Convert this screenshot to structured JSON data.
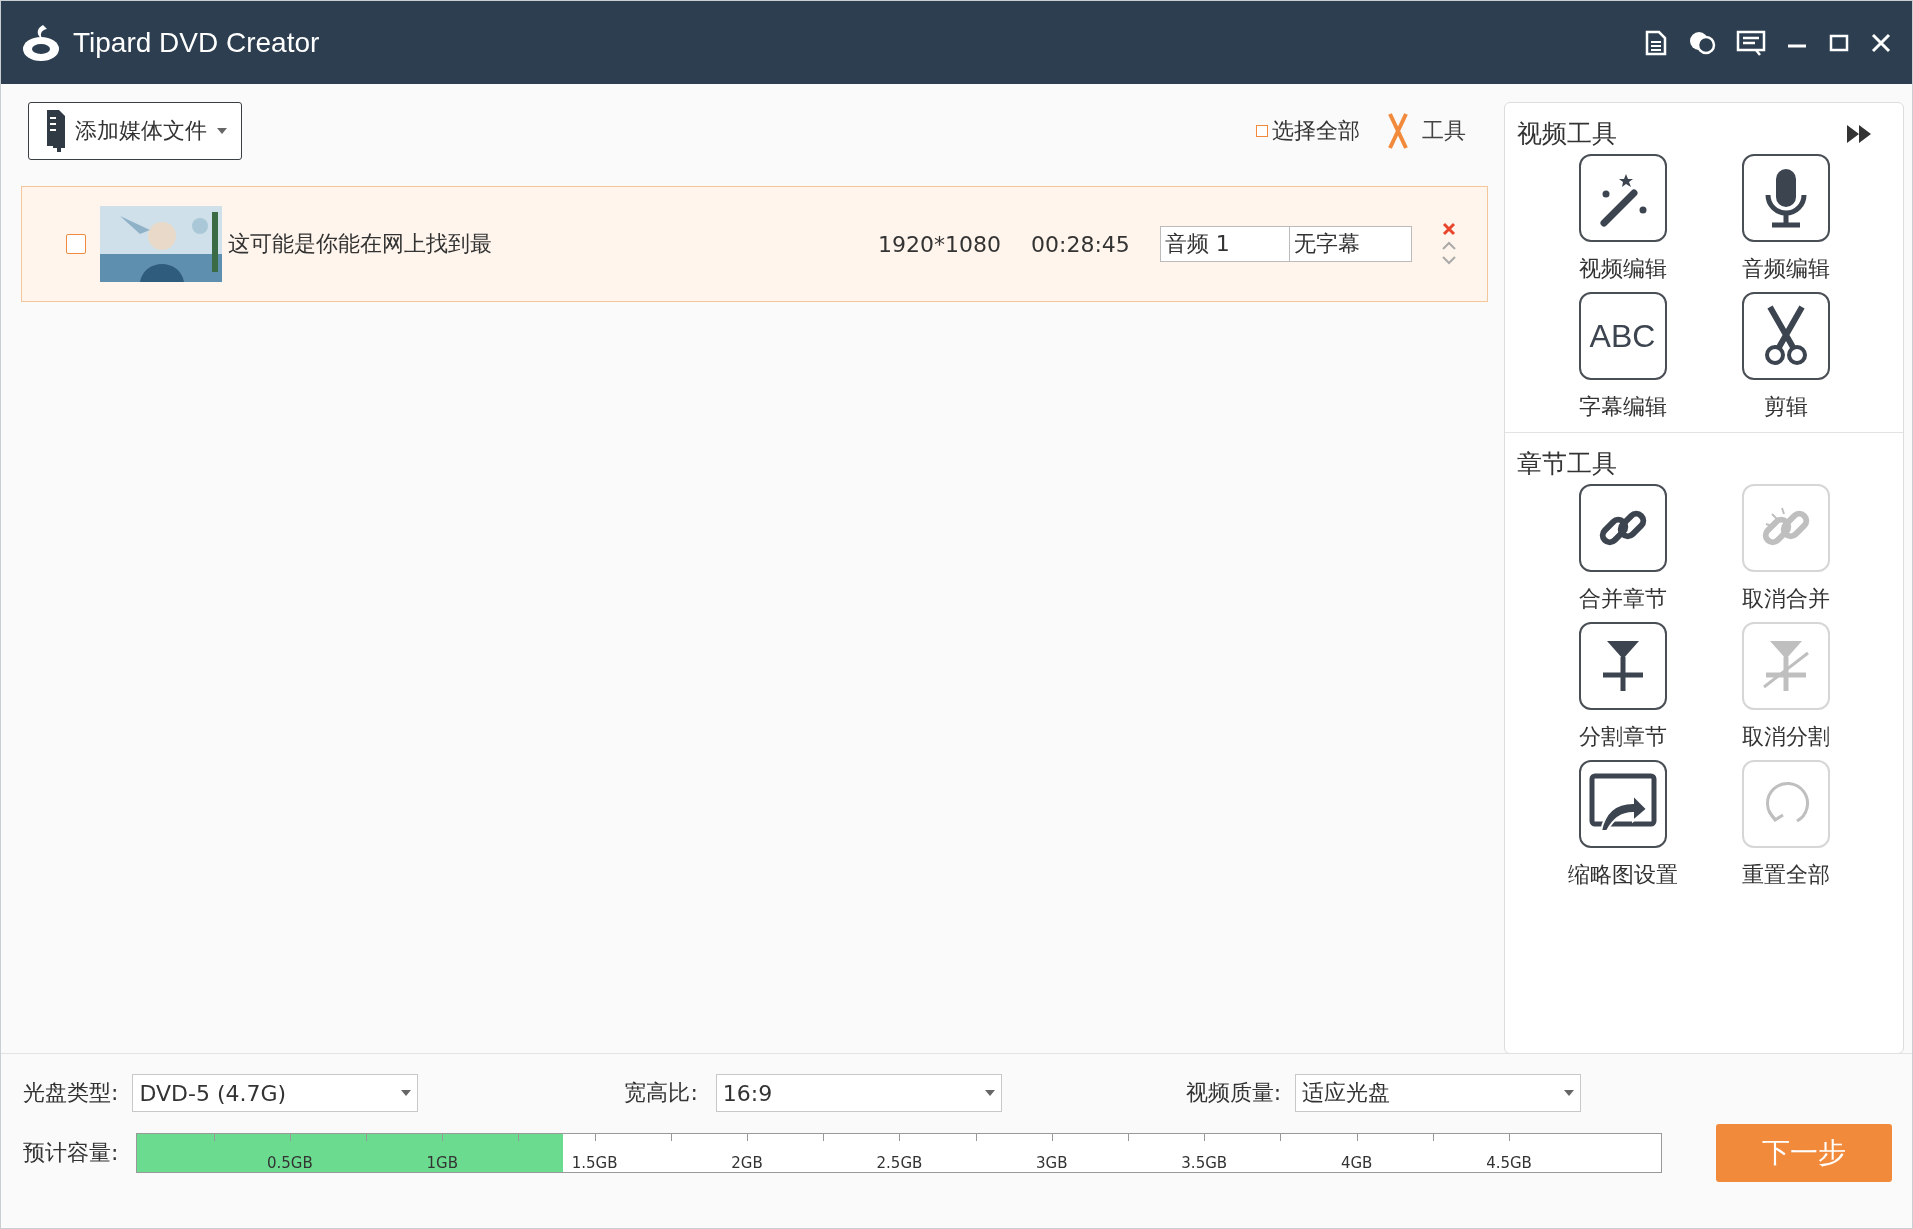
{
  "window": {
    "title": "Tipard DVD Creator"
  },
  "toolbar": {
    "add_button": "添加媒体文件",
    "select_all": {
      "label": "选择全部",
      "checked": false
    },
    "tools": "工具"
  },
  "files": [
    {
      "checked": false,
      "name": "这可能是你能在网上找到最",
      "resolution": "1920*1080",
      "duration": "00:28:45",
      "audio": "音频 1",
      "subtitle": "无字幕"
    }
  ],
  "video_tools": {
    "title": "视频工具",
    "items": [
      {
        "kind": "wand",
        "label": "视频编辑",
        "disabled": false
      },
      {
        "kind": "mic",
        "label": "音频编辑",
        "disabled": false
      },
      {
        "kind": "abc",
        "label": "字幕编辑",
        "disabled": false,
        "glyph": "ABC"
      },
      {
        "kind": "scissors",
        "label": "剪辑",
        "disabled": false
      }
    ]
  },
  "chapter_tools": {
    "title": "章节工具",
    "items": [
      {
        "kind": "link",
        "label": "合并章节",
        "disabled": false
      },
      {
        "kind": "unlink",
        "label": "取消合并",
        "disabled": true
      },
      {
        "kind": "split",
        "label": "分割章节",
        "disabled": false
      },
      {
        "kind": "unsplit",
        "label": "取消分割",
        "disabled": true
      },
      {
        "kind": "thumb",
        "label": "缩略图设置",
        "disabled": false
      },
      {
        "kind": "reset",
        "label": "重置全部",
        "disabled": true
      }
    ]
  },
  "settings": {
    "disc_type": {
      "label": "光盘类型:",
      "value": "DVD-5 (4.7G)"
    },
    "aspect": {
      "label": "宽高比:",
      "value": "16:9"
    },
    "quality": {
      "label": "视频质量:",
      "value": "适应光盘"
    }
  },
  "capacity": {
    "label": "预计容量:",
    "level": 0.279,
    "ticks": [
      "0.5GB",
      "1GB",
      "1.5GB",
      "2GB",
      "2.5GB",
      "3GB",
      "3.5GB",
      "4GB",
      "4.5GB"
    ]
  },
  "next_button": "下一步"
}
